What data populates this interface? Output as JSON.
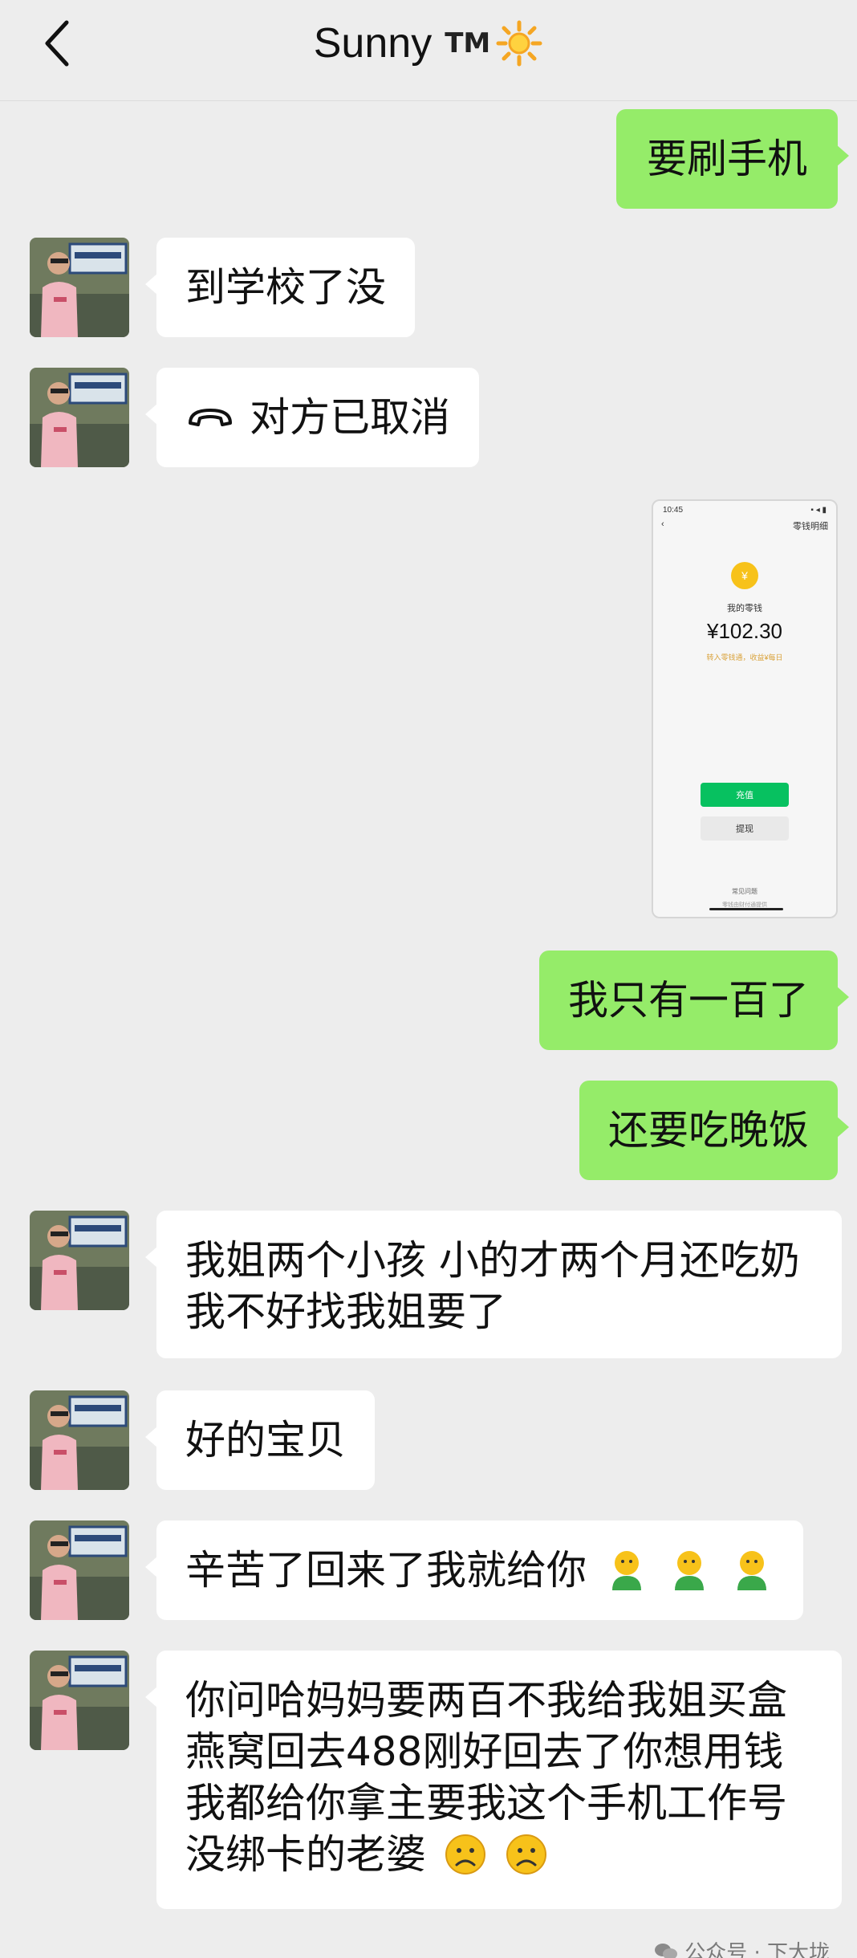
{
  "header": {
    "title": "Sunny",
    "tm": "TM"
  },
  "messages": [
    {
      "side": "out",
      "text": "要刷手机"
    },
    {
      "side": "in",
      "text": "到学校了没"
    },
    {
      "side": "in",
      "type": "call",
      "text": "对方已取消"
    },
    {
      "side": "out",
      "type": "image"
    },
    {
      "side": "out",
      "text": "我只有一百了"
    },
    {
      "side": "out",
      "text": "还要吃晚饭"
    },
    {
      "side": "in",
      "text": "我姐两个小孩 小的才两个月还吃奶我不好找我姐要了"
    },
    {
      "side": "in",
      "text": "好的宝贝"
    },
    {
      "side": "in",
      "text": "辛苦了回来了我就给你"
    },
    {
      "side": "in",
      "text": "你问哈妈妈要两百不我给我姐买盒燕窝回去488刚好回去了你想用钱我都给你拿主要我这个手机工作号没绑卡的老婆"
    }
  ],
  "wallet": {
    "time": "10:45",
    "top_right": "零钱明细",
    "label": "我的零钱",
    "amount": "¥102.30",
    "note": "转入零钱通，收益¥每日",
    "recharge": "充值",
    "withdraw": "提现",
    "footer1": "常见问题",
    "footer2": "零钱由财付通提供"
  },
  "watermark": "公众号 · 下大垅",
  "colors": {
    "outgoing": "#95ec69",
    "incoming": "#ffffff",
    "background": "#ededed",
    "wallet_green": "#07c160"
  }
}
